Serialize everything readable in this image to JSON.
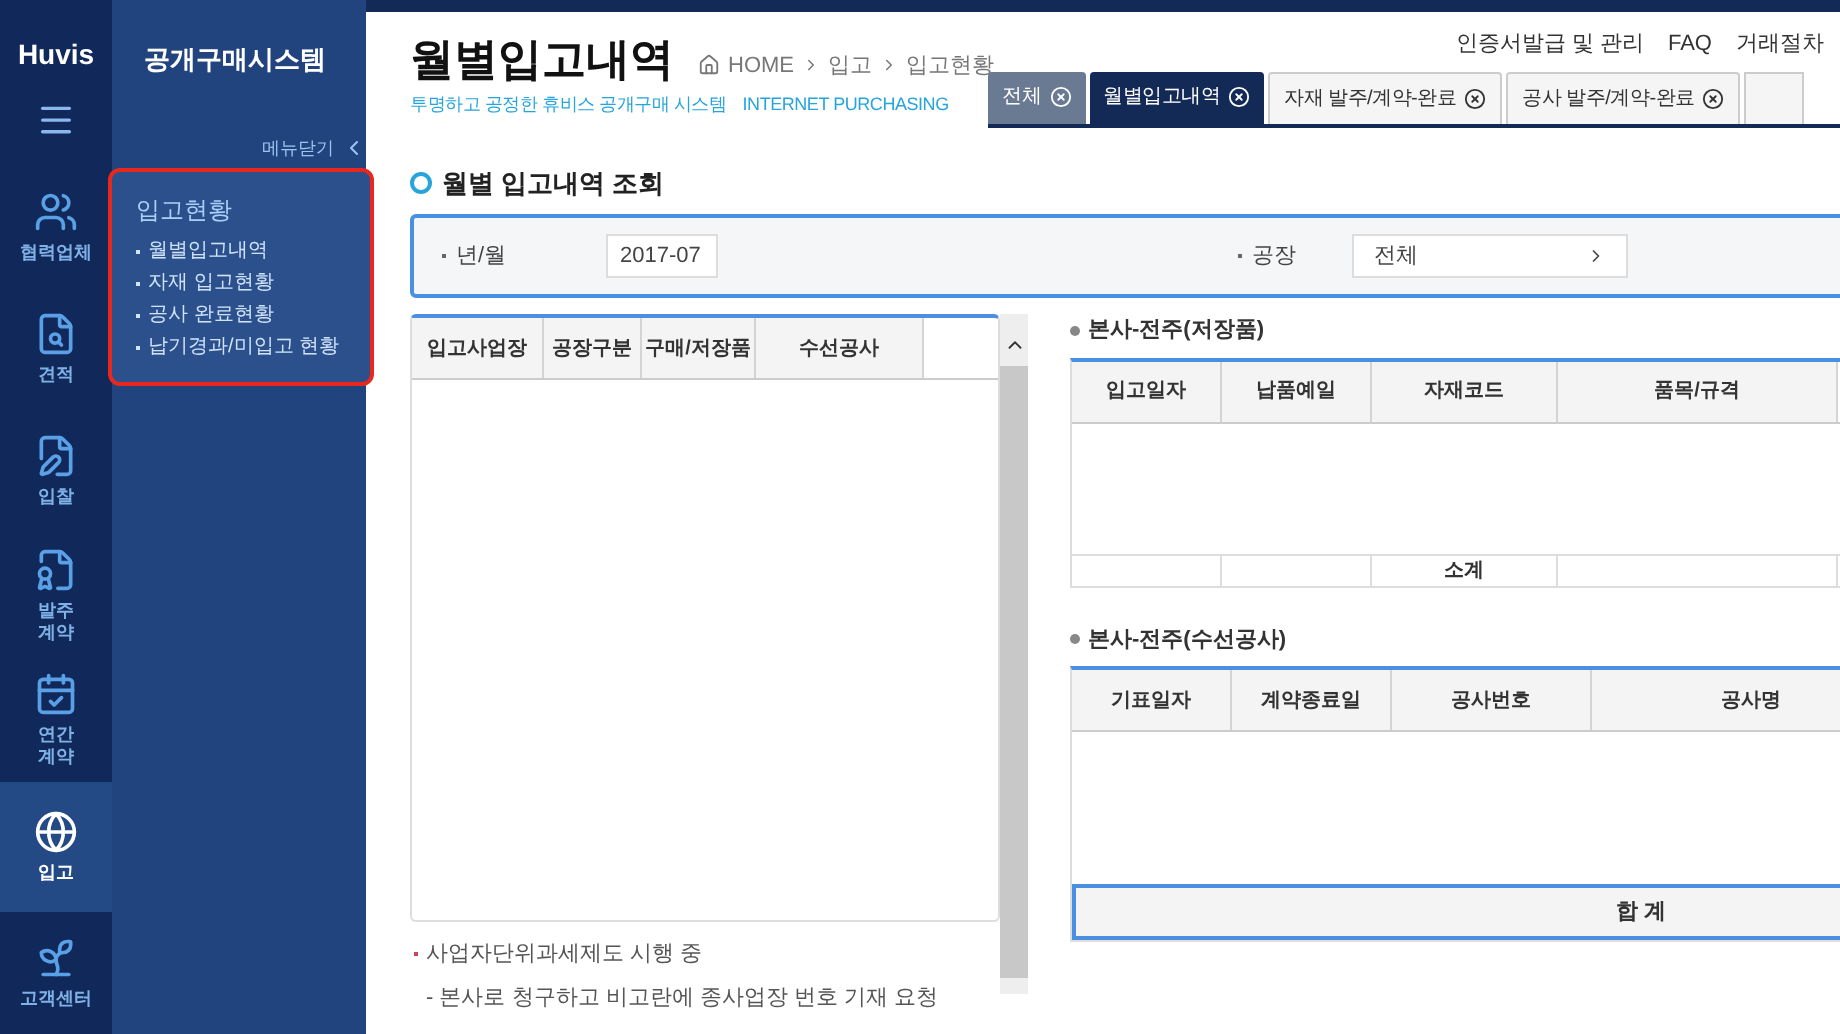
{
  "logo": "Huvis",
  "system_title": "공개구매시스템",
  "rail_items": [
    {
      "label": "협력업체",
      "selected": false
    },
    {
      "label": "견적",
      "selected": false
    },
    {
      "label": "입찰",
      "selected": false
    },
    {
      "label": "발주\n계약",
      "selected": false
    },
    {
      "label": "연간\n계약",
      "selected": false
    },
    {
      "label": "입고",
      "selected": true
    },
    {
      "label": "고객센터",
      "selected": false
    }
  ],
  "menu_toggle": "메뉴닫기",
  "submenu": {
    "title": "입고현황",
    "items": [
      "월별입고내역",
      "자재 입고현황",
      "공사 완료현황",
      "납기경과/미입고 현황"
    ]
  },
  "page_title": "월별입고내역",
  "breadcrumb": [
    "HOME",
    "입고",
    "입고현황"
  ],
  "tagline": "투명하고 공정한 휴비스 공개구매 시스템",
  "tagline_en": "INTERNET PURCHASING",
  "top_links": [
    "인증서발급 및 관리",
    "FAQ",
    "거래절차"
  ],
  "tabs": [
    {
      "label": "전체",
      "selected": false
    },
    {
      "label": "월별입고내역",
      "selected": true
    },
    {
      "label": "자재 발주/계약-완료",
      "selected": false
    },
    {
      "label": "공사 발주/계약-완료",
      "selected": false
    }
  ],
  "section_title": "월별 입고내역 조회",
  "search": {
    "month_label": "년/월",
    "month_value": "2017-07",
    "plant_label": "공장",
    "plant_value": "전체"
  },
  "left_table": {
    "columns": [
      "입고사업장",
      "공장구분",
      "구매/저장품",
      "수선공사"
    ]
  },
  "notes": [
    "사업자단위과세제도 시행 중",
    "- 본사로 청구하고 비고란에 종사업장 번호 기재 요청"
  ],
  "stock_section": {
    "title": "본사-전주(저장품)",
    "columns": [
      "입고일자",
      "납품예일",
      "자재코드",
      "품목/규격"
    ],
    "subtotal": "소계"
  },
  "repair_section": {
    "title": "본사-전주(수선공사)",
    "columns": [
      "기표일자",
      "계약종료일",
      "공사번호",
      "공사명"
    ],
    "total": "합 계"
  }
}
